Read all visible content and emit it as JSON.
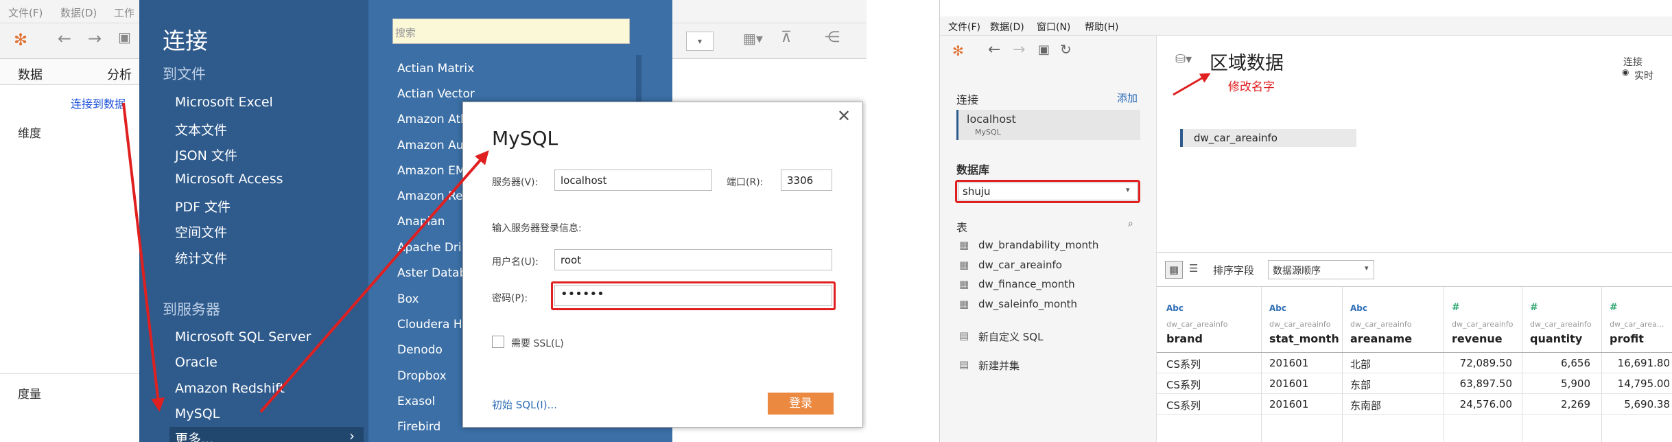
{
  "left": {
    "menubar": [
      "文件(F)",
      "数据(D)",
      "工作"
    ],
    "tabs": {
      "data": "数据",
      "analysis": "分析"
    },
    "connect_link": "连接到数据",
    "dimensions": "维度",
    "measures": "度量",
    "connect": {
      "title": "连接",
      "to_file": "到文件",
      "file_items": [
        "Microsoft Excel",
        "文本文件",
        "JSON 文件",
        "Microsoft Access",
        "PDF 文件",
        "空间文件",
        "统计文件"
      ],
      "to_server": "到服务器",
      "server_items": [
        "Microsoft SQL Server",
        "Oracle",
        "Amazon Redshift",
        "MySQL",
        "更多..."
      ],
      "search_placeholder": "搜索",
      "list": [
        "Actian Matrix",
        "Actian Vector",
        "Amazon Ath",
        "Amazon Au",
        "Amazon EM",
        "Amazon Ree",
        "Anaplan",
        "Apache Drill",
        "Aster Datab",
        "Box",
        "Cloudera Ha",
        "Denodo",
        "Dropbox",
        "Exasol",
        "Firebird"
      ]
    },
    "dialog": {
      "title": "MySQL",
      "server_label": "服务器(V):",
      "server_value": "localhost",
      "port_label": "端口(R):",
      "port_value": "3306",
      "login_hint": "输入服务器登录信息:",
      "user_label": "用户名(U):",
      "user_value": "root",
      "password_label": "密码(P):",
      "password_value": "••••••",
      "ssl_label": "需要 SSL(L)",
      "initial_sql": "初始 SQL(I)...",
      "login_button": "登录"
    }
  },
  "right": {
    "menubar": [
      "文件(F)",
      "数据(D)",
      "窗口(N)",
      "帮助(H)"
    ],
    "connections_label": "连接",
    "add_label": "添加",
    "connection": {
      "name": "localhost",
      "type": "MySQL"
    },
    "database_label": "数据库",
    "database_value": "shuju",
    "tables_label": "表",
    "tables": [
      "dw_brandability_month",
      "dw_car_areainfo",
      "dw_finance_month",
      "dw_saleinfo_month"
    ],
    "custom_sql": "新自定义 SQL",
    "union": "新建并集",
    "datasource_title": "区域数据",
    "rename_note": "修改名字",
    "connection_mode_label": "连接",
    "connection_mode_value": "实时",
    "canvas_table": "dw_car_areainfo",
    "sort_label": "排序字段",
    "sort_value": "数据源顺序",
    "columns": [
      {
        "type": "Abc",
        "source": "dw_car_areainfo",
        "name": "brand"
      },
      {
        "type": "Abc",
        "source": "dw_car_areainfo",
        "name": "stat_month"
      },
      {
        "type": "Abc",
        "source": "dw_car_areainfo",
        "name": "areaname"
      },
      {
        "type": "#",
        "source": "dw_car_areainfo",
        "name": "revenue"
      },
      {
        "type": "#",
        "source": "dw_car_areainfo",
        "name": "quantity"
      },
      {
        "type": "#",
        "source": "dw_car_area...",
        "name": "profit"
      }
    ],
    "rows": [
      [
        "CS系列",
        "201601",
        "北部",
        "72,089.50",
        "6,656",
        "16,691.80"
      ],
      [
        "CS系列",
        "201601",
        "东部",
        "63,897.50",
        "5,900",
        "14,795.00"
      ],
      [
        "CS系列",
        "201601",
        "东南部",
        "24,576.00",
        "2,269",
        "5,690.38"
      ]
    ]
  },
  "colors": {
    "accent_red": "#e02020",
    "tableau_blue": "#2e5a8c",
    "login_orange": "#ec8940"
  }
}
